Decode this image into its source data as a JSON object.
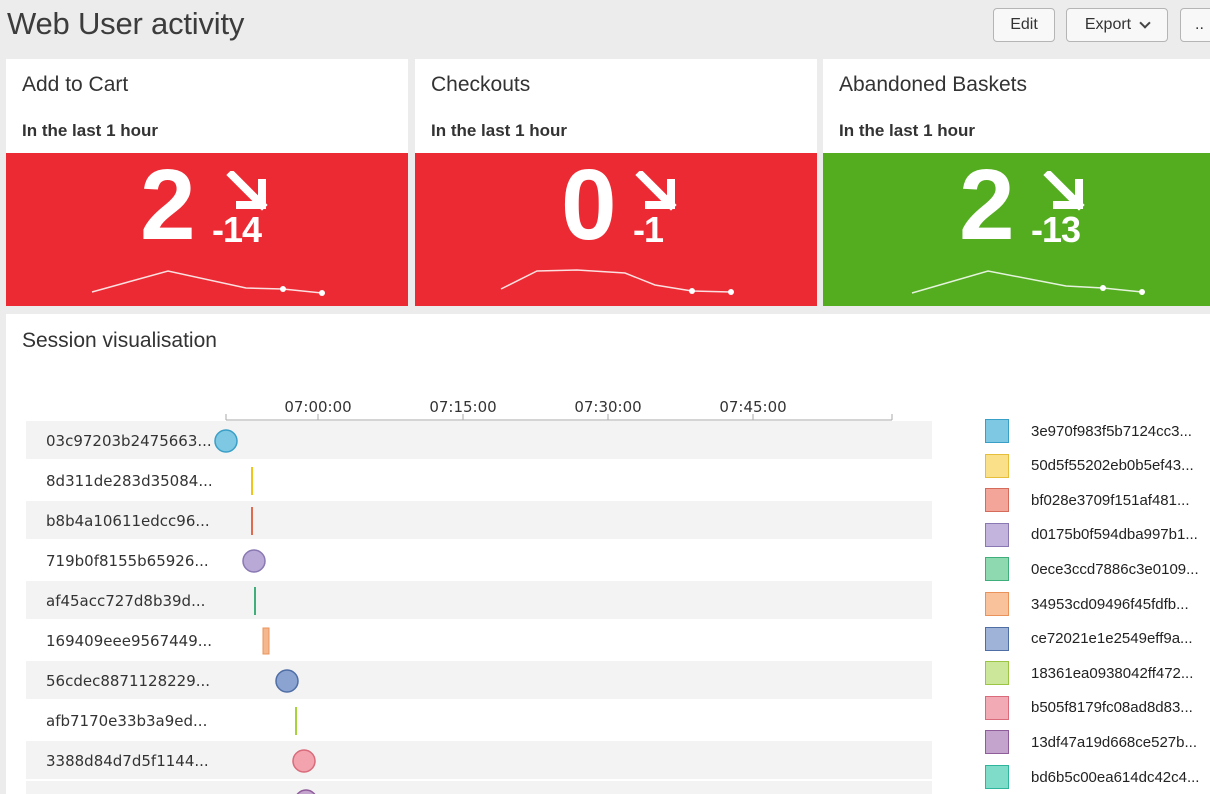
{
  "page": {
    "title": "Web User activity"
  },
  "toolbar": {
    "edit_label": "Edit",
    "export_label": "Export",
    "more_label": ".."
  },
  "panels": [
    {
      "title": "Add to Cart",
      "subtitle": "In the last 1 hour",
      "value": "2",
      "delta": "-14",
      "trend": "down",
      "color": "#ec2a33",
      "sparkline": [
        0,
        8,
        14,
        7,
        3,
        2,
        0
      ]
    },
    {
      "title": "Checkouts",
      "subtitle": "In the last 1 hour",
      "value": "0",
      "delta": "-1",
      "trend": "down",
      "color": "#ec2a33",
      "sparkline": [
        0,
        12,
        12,
        11,
        4,
        0,
        0
      ]
    },
    {
      "title": "Abandoned Baskets",
      "subtitle": "In the last 1 hour",
      "value": "2",
      "delta": "-13",
      "trend": "down",
      "color": "#53ad1f",
      "sparkline": [
        0,
        10,
        14,
        6,
        2,
        2,
        0
      ]
    }
  ],
  "session": {
    "title": "Session visualisation",
    "axis_ticks": [
      "07:00:00",
      "07:15:00",
      "07:30:00",
      "07:45:00"
    ],
    "rows": [
      {
        "label": "03c97203b2475663...",
        "marker": "circle",
        "color": "#7ec8e3",
        "stroke": "#3a9fc7"
      },
      {
        "label": "8d311de283d35084...",
        "marker": "line",
        "color": "#f0c419",
        "stroke": "#f0c419"
      },
      {
        "label": "b8b4a10611edcc96...",
        "marker": "line",
        "color": "#e06a4e",
        "stroke": "#e06a4e"
      },
      {
        "label": "719b0f8155b65926...",
        "marker": "circle",
        "color": "#b9a9d6",
        "stroke": "#8a78b3"
      },
      {
        "label": "af45acc727d8b39d...",
        "marker": "line",
        "color": "#3fae7a",
        "stroke": "#3fae7a"
      },
      {
        "label": "169409eee9567449...",
        "marker": "bar",
        "color": "#f5b88e",
        "stroke": "#e9935a"
      },
      {
        "label": "56cdec8871128229...",
        "marker": "circle",
        "color": "#8aa3d0",
        "stroke": "#4f6ea6"
      },
      {
        "label": "afb7170e33b3a9ed...",
        "marker": "line",
        "color": "#a6d23c",
        "stroke": "#a6d23c"
      },
      {
        "label": "3388d84d7d5f1144...",
        "marker": "circle",
        "color": "#f2a3ae",
        "stroke": "#d96b7a"
      }
    ],
    "legend": [
      {
        "label": "3e970f983f5b7124cc3...",
        "color": "#7ec8e3",
        "border": "#3a9fc7"
      },
      {
        "label": "50d5f55202eb0b5ef43...",
        "color": "#fbe08a",
        "border": "#e5bf3c"
      },
      {
        "label": "bf028e3709f151af481...",
        "color": "#f4a59a",
        "border": "#d46b5b"
      },
      {
        "label": "d0175b0f594dba997b1...",
        "color": "#c3b4dd",
        "border": "#8a78b3"
      },
      {
        "label": "0ece3ccd7886c3e0109...",
        "color": "#8fd9b1",
        "border": "#3fae7a"
      },
      {
        "label": "34953cd09496f45fdfb...",
        "color": "#f9c29b",
        "border": "#e9935a"
      },
      {
        "label": "ce72021e1e2549eff9a...",
        "color": "#9fb3d9",
        "border": "#4f6ea6"
      },
      {
        "label": "18361ea0938042ff472...",
        "color": "#cde79a",
        "border": "#9cc544"
      },
      {
        "label": "b505f8179fc08ad8d83...",
        "color": "#f2aab4",
        "border": "#d96b7a"
      },
      {
        "label": "13df47a19d668ce527b...",
        "color": "#c4a3cd",
        "border": "#8f5d9c"
      },
      {
        "label": "bd6b5c00ea614dc42c4...",
        "color": "#7fdcc8",
        "border": "#2fb59b"
      }
    ]
  }
}
